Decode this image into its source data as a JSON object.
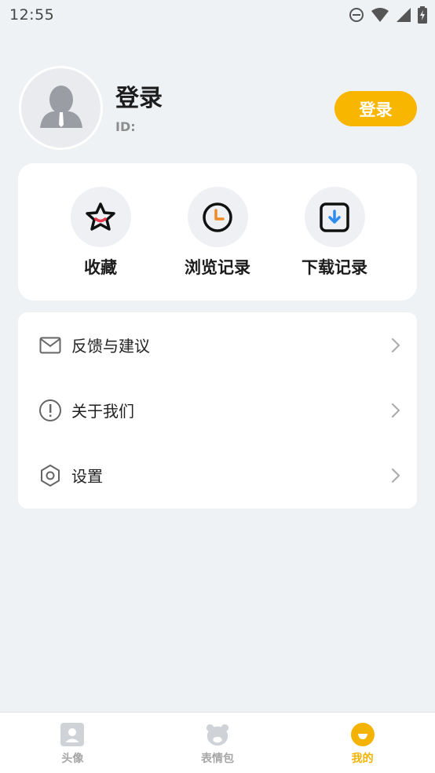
{
  "status_bar": {
    "time": "12:55"
  },
  "profile": {
    "name": "登录",
    "id_label": "ID:",
    "login_button": "登录"
  },
  "quick_actions": [
    {
      "label": "收藏",
      "icon": "star-icon"
    },
    {
      "label": "浏览记录",
      "icon": "clock-icon"
    },
    {
      "label": "下载记录",
      "icon": "download-icon"
    }
  ],
  "menu": [
    {
      "label": "反馈与建议",
      "icon": "mail-icon"
    },
    {
      "label": "关于我们",
      "icon": "info-exclamation-icon"
    },
    {
      "label": "设置",
      "icon": "settings-hexagon-icon"
    }
  ],
  "bottom_nav": [
    {
      "label": "头像",
      "icon": "avatar-card-icon",
      "active": false
    },
    {
      "label": "表情包",
      "icon": "bear-face-icon",
      "active": false
    },
    {
      "label": "我的",
      "icon": "profile-face-icon",
      "active": true
    }
  ],
  "colors": {
    "accent": "#f8b600",
    "background": "#eff2f5",
    "active_nav": "#f3b300"
  }
}
